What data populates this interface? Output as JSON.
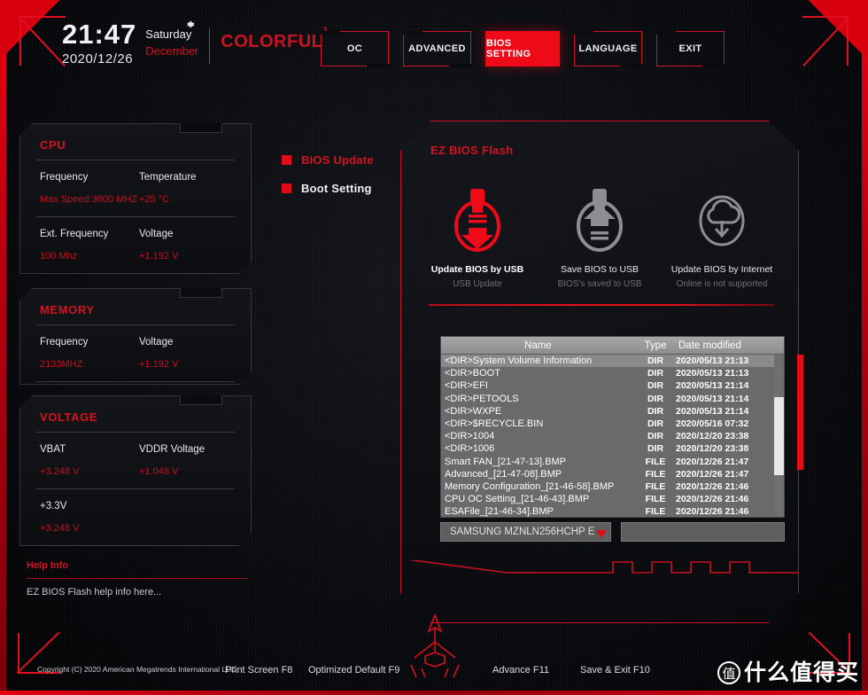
{
  "header": {
    "time": "21:47",
    "date": "2020/12/26",
    "day_of_week": "Saturday",
    "month": "December",
    "brand": "COLORFUL",
    "brand_sup": "3",
    "gear_icon": "gear-icon"
  },
  "tabs": [
    {
      "label": "OC",
      "active": false
    },
    {
      "label": "ADVANCED",
      "active": false
    },
    {
      "label": "BIOS SETTING",
      "active": true
    },
    {
      "label": "LANGUAGE",
      "active": false
    },
    {
      "label": "EXIT",
      "active": false
    }
  ],
  "sidebar": {
    "cpu": {
      "title": "CPU",
      "rows": [
        {
          "label_a": "Frequency",
          "value_a": "Max Speed:3600 MHZ",
          "label_b": "Temperature",
          "value_b": "+25 °C"
        },
        {
          "label_a": "Ext. Frequency",
          "value_a": "100 Mhz",
          "label_b": "Voltage",
          "value_b": "+1.192 V"
        }
      ]
    },
    "memory": {
      "title": "MEMORY",
      "rows": [
        {
          "label_a": "Frequency",
          "value_a": "2133MHZ",
          "label_b": "Voltage",
          "value_b": "+1.192 V"
        }
      ]
    },
    "voltage": {
      "title": "VOLTAGE",
      "rows": [
        {
          "label_a": "VBAT",
          "value_a": "+3.248 V",
          "label_b": "VDDR Voltage",
          "value_b": "+1.048 V"
        },
        {
          "label_a": "+3.3V",
          "value_a": "+3.248 V",
          "label_b": "",
          "value_b": ""
        }
      ]
    },
    "help": {
      "title": "Help Info",
      "text": "EZ BIOS Flash help info here..."
    }
  },
  "menu": {
    "items": [
      {
        "label": "BIOS Update",
        "active": true
      },
      {
        "label": "Boot Setting",
        "active": false
      }
    ]
  },
  "panel": {
    "title": "EZ BIOS Flash",
    "actions": [
      {
        "label": "Update BIOS by USB",
        "sub": "USB Update",
        "icon": "usb-download-icon",
        "enabled": true
      },
      {
        "label": "Save BIOS to USB",
        "sub": "BIOS’s saved to USB",
        "icon": "usb-upload-icon",
        "enabled": false
      },
      {
        "label": "Update BIOS by Internet",
        "sub": "Online is not supported",
        "icon": "cloud-download-icon",
        "enabled": false
      }
    ]
  },
  "filelist": {
    "columns": [
      "Name",
      "Type",
      "Date modified"
    ],
    "rows": [
      {
        "name": "<DIR>System Volume Information",
        "type": "DIR",
        "date": "2020/05/13 21:13",
        "selected": true
      },
      {
        "name": "<DIR>BOOT",
        "type": "DIR",
        "date": "2020/05/13 21:13",
        "selected": false
      },
      {
        "name": "<DIR>EFI",
        "type": "DIR",
        "date": "2020/05/13 21:14",
        "selected": false
      },
      {
        "name": "<DIR>PETOOLS",
        "type": "DIR",
        "date": "2020/05/13 21:14",
        "selected": false
      },
      {
        "name": "<DIR>WXPE",
        "type": "DIR",
        "date": "2020/05/13 21:14",
        "selected": false
      },
      {
        "name": "<DIR>$RECYCLE.BIN",
        "type": "DIR",
        "date": "2020/05/16 07:32",
        "selected": false
      },
      {
        "name": "<DIR>1004",
        "type": "DIR",
        "date": "2020/12/20 23:38",
        "selected": false
      },
      {
        "name": "<DIR>1006",
        "type": "DIR",
        "date": "2020/12/20 23:38",
        "selected": false
      },
      {
        "name": "Smart FAN_[21-47-13].BMP",
        "type": "FILE",
        "date": "2020/12/26 21:47",
        "selected": false
      },
      {
        "name": "Advanced_[21-47-08].BMP",
        "type": "FILE",
        "date": "2020/12/26 21:47",
        "selected": false
      },
      {
        "name": "Memory Configuration_[21-46-58].BMP",
        "type": "FILE",
        "date": "2020/12/26 21:46",
        "selected": false
      },
      {
        "name": "CPU OC Setting_[21-46-43].BMP",
        "type": "FILE",
        "date": "2020/12/26 21:46",
        "selected": false
      },
      {
        "name": "ESAFile_[21-46-34].BMP",
        "type": "FILE",
        "date": "2020/12/26 21:46",
        "selected": false
      }
    ]
  },
  "drive": {
    "selected": "SAMSUNG MZNLN256HCHP E",
    "arrow_icon": "chevron-down-icon"
  },
  "footer": {
    "copyright": "Copyright (C) 2020 American Megatrends International LLC",
    "keys": [
      "Print Screen F8",
      "Optimized Default F9",
      "Advance F11",
      "Save & Exit F10"
    ]
  },
  "watermark": {
    "logo": "值",
    "text": "什么值得买"
  },
  "colors": {
    "accent_red": "#e00c18",
    "title_red": "#d31322",
    "value_red": "#c41020",
    "panel_border": "#c91020",
    "text_light": "#f0f0f2"
  }
}
